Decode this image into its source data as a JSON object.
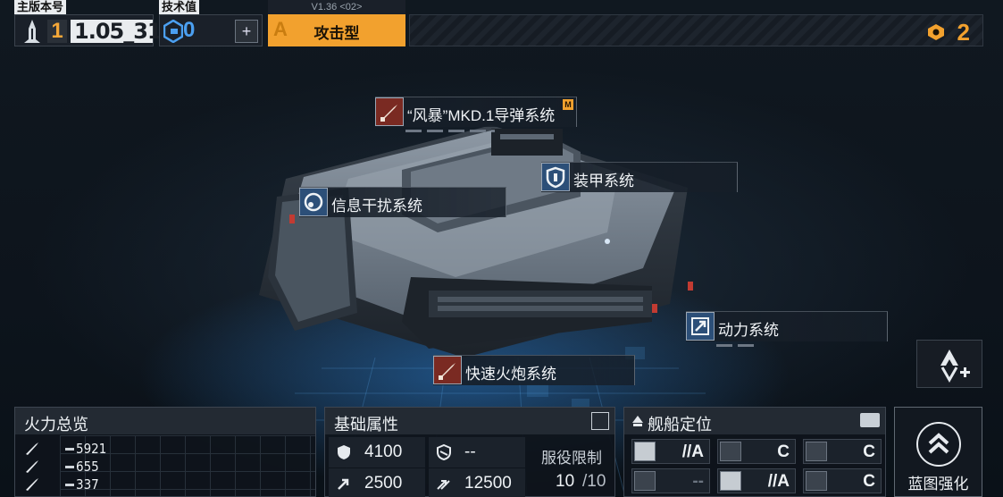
{
  "top_bar": {
    "version_label": "主版本号",
    "version_major": "1",
    "version_minor": "1.05_31",
    "tech_label": "技术值",
    "tech_value": "0",
    "tech_button_icon": "plus-icon",
    "ship_version": "V1.36 <02>",
    "type_letter": "A",
    "ship_type": "攻击型",
    "resource_count": "2",
    "accent_color": "#f2a12e"
  },
  "callouts": {
    "missile": {
      "label": "“风暴”MKD.1导弹系统",
      "tag": "M",
      "icon": "missile-icon"
    },
    "armor": {
      "label": "装甲系统",
      "icon": "shield-icon"
    },
    "jamming": {
      "label": "信息干扰系统",
      "icon": "radar-icon"
    },
    "power": {
      "label": "动力系统",
      "icon": "engine-icon"
    },
    "cannon": {
      "label": "快速火炮系统",
      "icon": "cannon-icon"
    }
  },
  "firepower": {
    "title": "火力总览",
    "rows": [
      {
        "icon": "missile-icon",
        "value": "5921"
      },
      {
        "icon": "missile-icon",
        "value": "655"
      },
      {
        "icon": "missile-icon",
        "value": "337"
      }
    ]
  },
  "attributes": {
    "title": "基础属性",
    "hp": "4100",
    "shield": "--",
    "speed": "2500",
    "warp_speed": "12500",
    "service_label": "服役限制",
    "service_current": "10",
    "service_max": "/10"
  },
  "role": {
    "title": "舰船定位",
    "cells": [
      {
        "grade": "//A",
        "dim": false
      },
      {
        "grade": "C",
        "dim": false
      },
      {
        "grade": "C",
        "dim": false
      },
      {
        "grade": "--",
        "dim": true
      },
      {
        "grade": "//A",
        "dim": false
      },
      {
        "grade": "C",
        "dim": false
      }
    ]
  },
  "enhance": {
    "label": "蓝图强化"
  }
}
